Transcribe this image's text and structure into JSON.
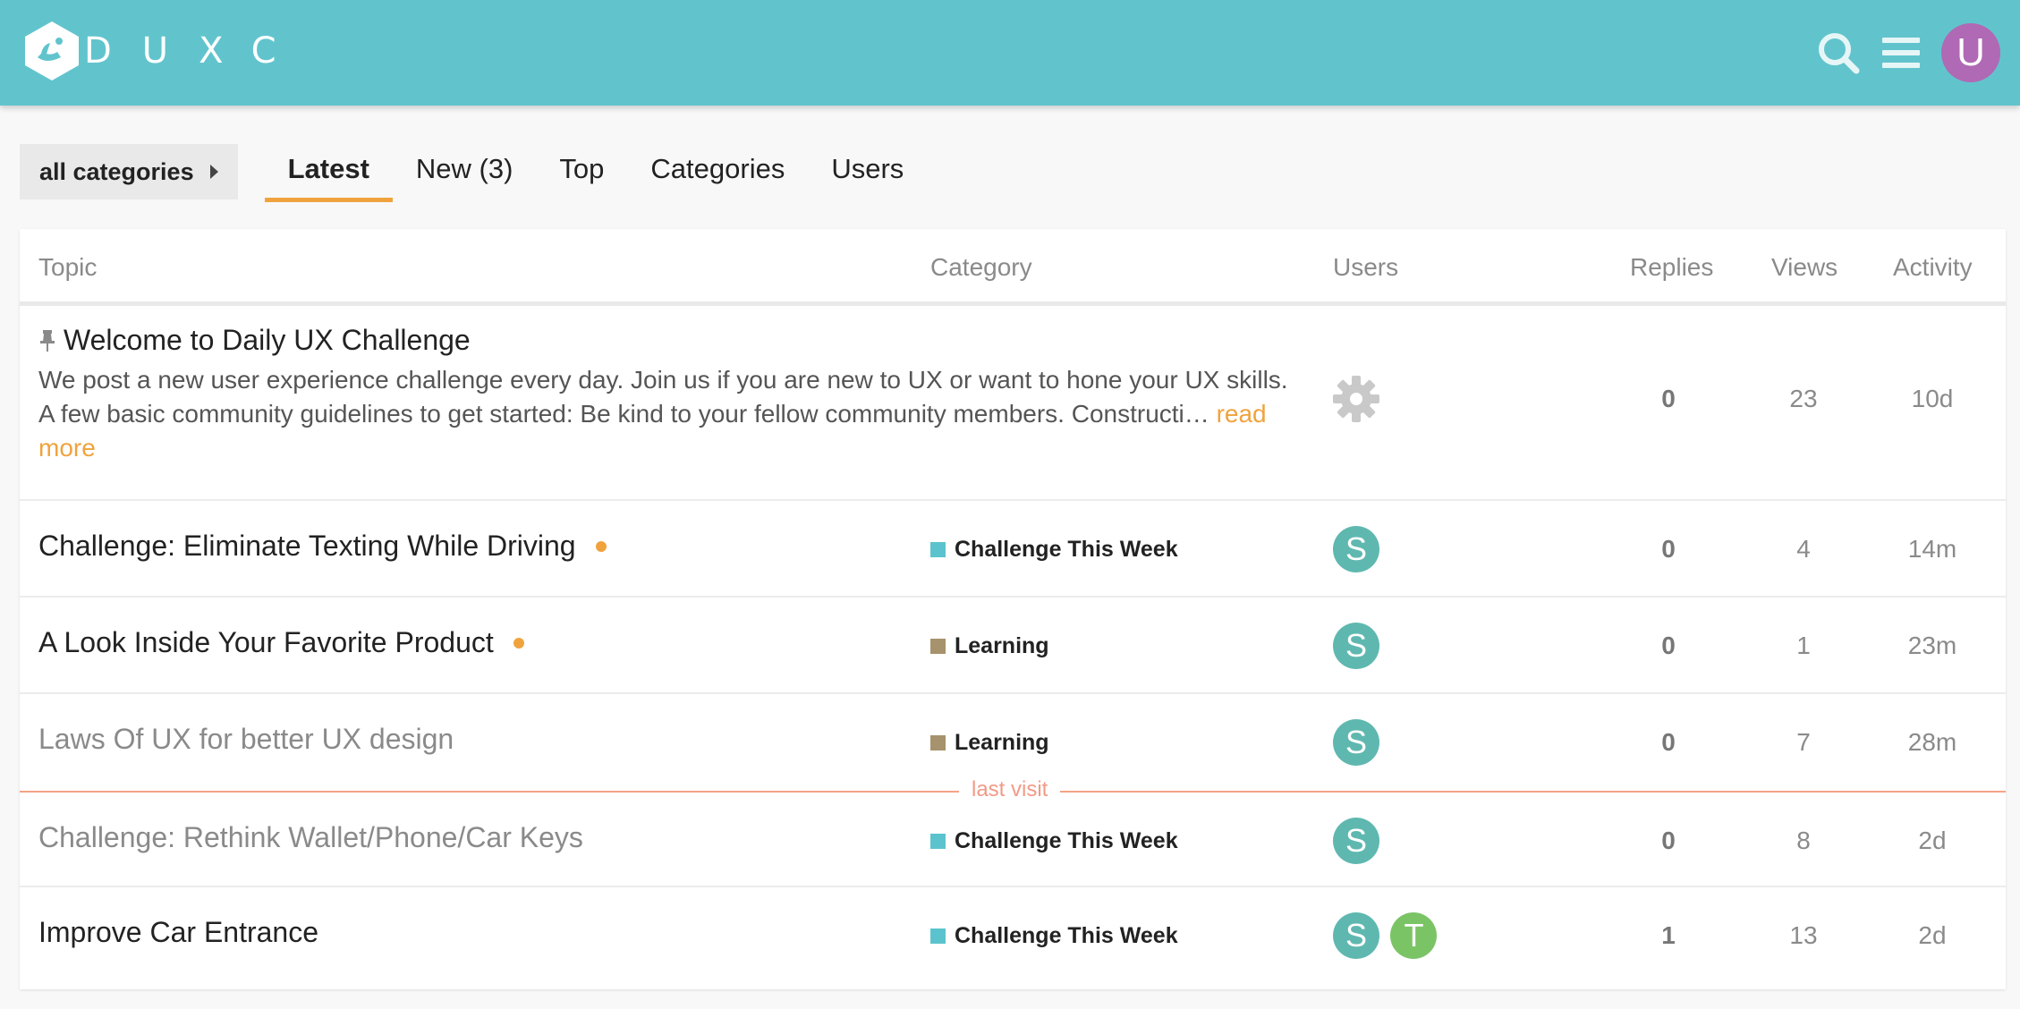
{
  "header": {
    "logo_text": "DUXC",
    "icons": [
      "search-icon",
      "menu-icon"
    ],
    "avatar_letter": "U",
    "avatar_color": "#b069b4",
    "bg_color": "#61c4cd"
  },
  "nav": {
    "category_dropdown": "all categories",
    "tabs": [
      {
        "label": "Latest",
        "active": true
      },
      {
        "label": "New (3)"
      },
      {
        "label": "Top"
      },
      {
        "label": "Categories"
      },
      {
        "label": "Users"
      }
    ]
  },
  "table": {
    "headers": {
      "topic": "Topic",
      "category": "Category",
      "users": "Users",
      "replies": "Replies",
      "views": "Views",
      "activity": "Activity"
    },
    "pinned": {
      "title": "Welcome to Daily UX Challenge",
      "excerpt": "We post a new user experience challenge every day. Join us if you are new to UX or want to hone your UX skills. A few basic community guidelines to get started: Be kind to your fellow community members. Constructi…",
      "read_more": "read more",
      "replies": "0",
      "views": "23",
      "activity": "10d"
    },
    "rows": [
      {
        "title": "Challenge: Eliminate Texting While Driving",
        "new": true,
        "category": "Challenge This Week",
        "cat_color": "#5bc3cd",
        "users": [
          "S"
        ],
        "replies": "0",
        "views": "4",
        "activity": "14m"
      },
      {
        "title": "A Look Inside Your Favorite Product",
        "new": true,
        "category": "Learning",
        "cat_color": "#a6926c",
        "users": [
          "S"
        ],
        "replies": "0",
        "views": "1",
        "activity": "23m"
      },
      {
        "title": "Laws Of UX for better UX design",
        "visited": true,
        "category": "Learning",
        "cat_color": "#a6926c",
        "users": [
          "S"
        ],
        "replies": "0",
        "views": "7",
        "activity": "28m"
      },
      {
        "title": "Challenge: Rethink Wallet/Phone/Car Keys",
        "visited": true,
        "category": "Challenge This Week",
        "cat_color": "#5bc3cd",
        "users": [
          "S"
        ],
        "replies": "0",
        "views": "8",
        "activity": "2d"
      },
      {
        "title": "Improve Car Entrance",
        "category": "Challenge This Week",
        "cat_color": "#5bc3cd",
        "users": [
          "S",
          "T"
        ],
        "replies": "1",
        "views": "13",
        "activity": "2d"
      }
    ],
    "last_visit_label": "last visit",
    "user_colors": {
      "S": "#5fb8b0",
      "T": "#7bc466"
    }
  }
}
